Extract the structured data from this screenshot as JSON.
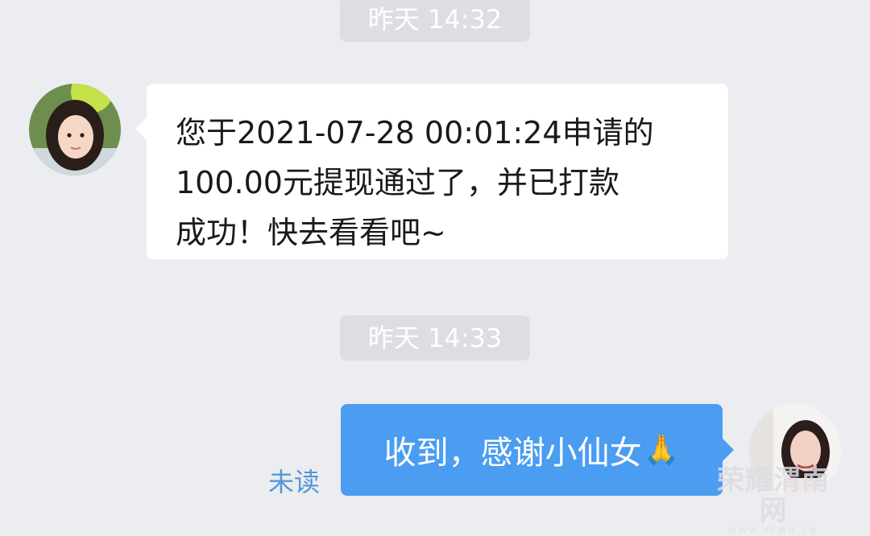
{
  "chat": {
    "messages": [
      {
        "timestamp": "昨天 14:32",
        "direction": "incoming",
        "lines": [
          "您于2021-07-28 00:01:24申请的",
          "100.00元提现通过了，并已打款",
          "成功！快去看看吧~"
        ]
      },
      {
        "timestamp": "昨天 14:33",
        "direction": "outgoing",
        "text": "收到，感谢小仙女",
        "emoji": "🙏",
        "status": "未读"
      }
    ]
  },
  "watermark": {
    "main": "荣耀渭南网",
    "sub": "WWW.YEWN.CN"
  },
  "colors": {
    "background": "#EBEDF0",
    "incoming_bubble": "#FFFFFF",
    "outgoing_bubble": "#4A9DF0",
    "unread_text": "#5596D8",
    "timestamp_pill": "#DCDEE1"
  },
  "icons": {
    "incoming_avatar": "girl-portrait-avatar",
    "outgoing_avatar": "woman-portrait-avatar"
  }
}
